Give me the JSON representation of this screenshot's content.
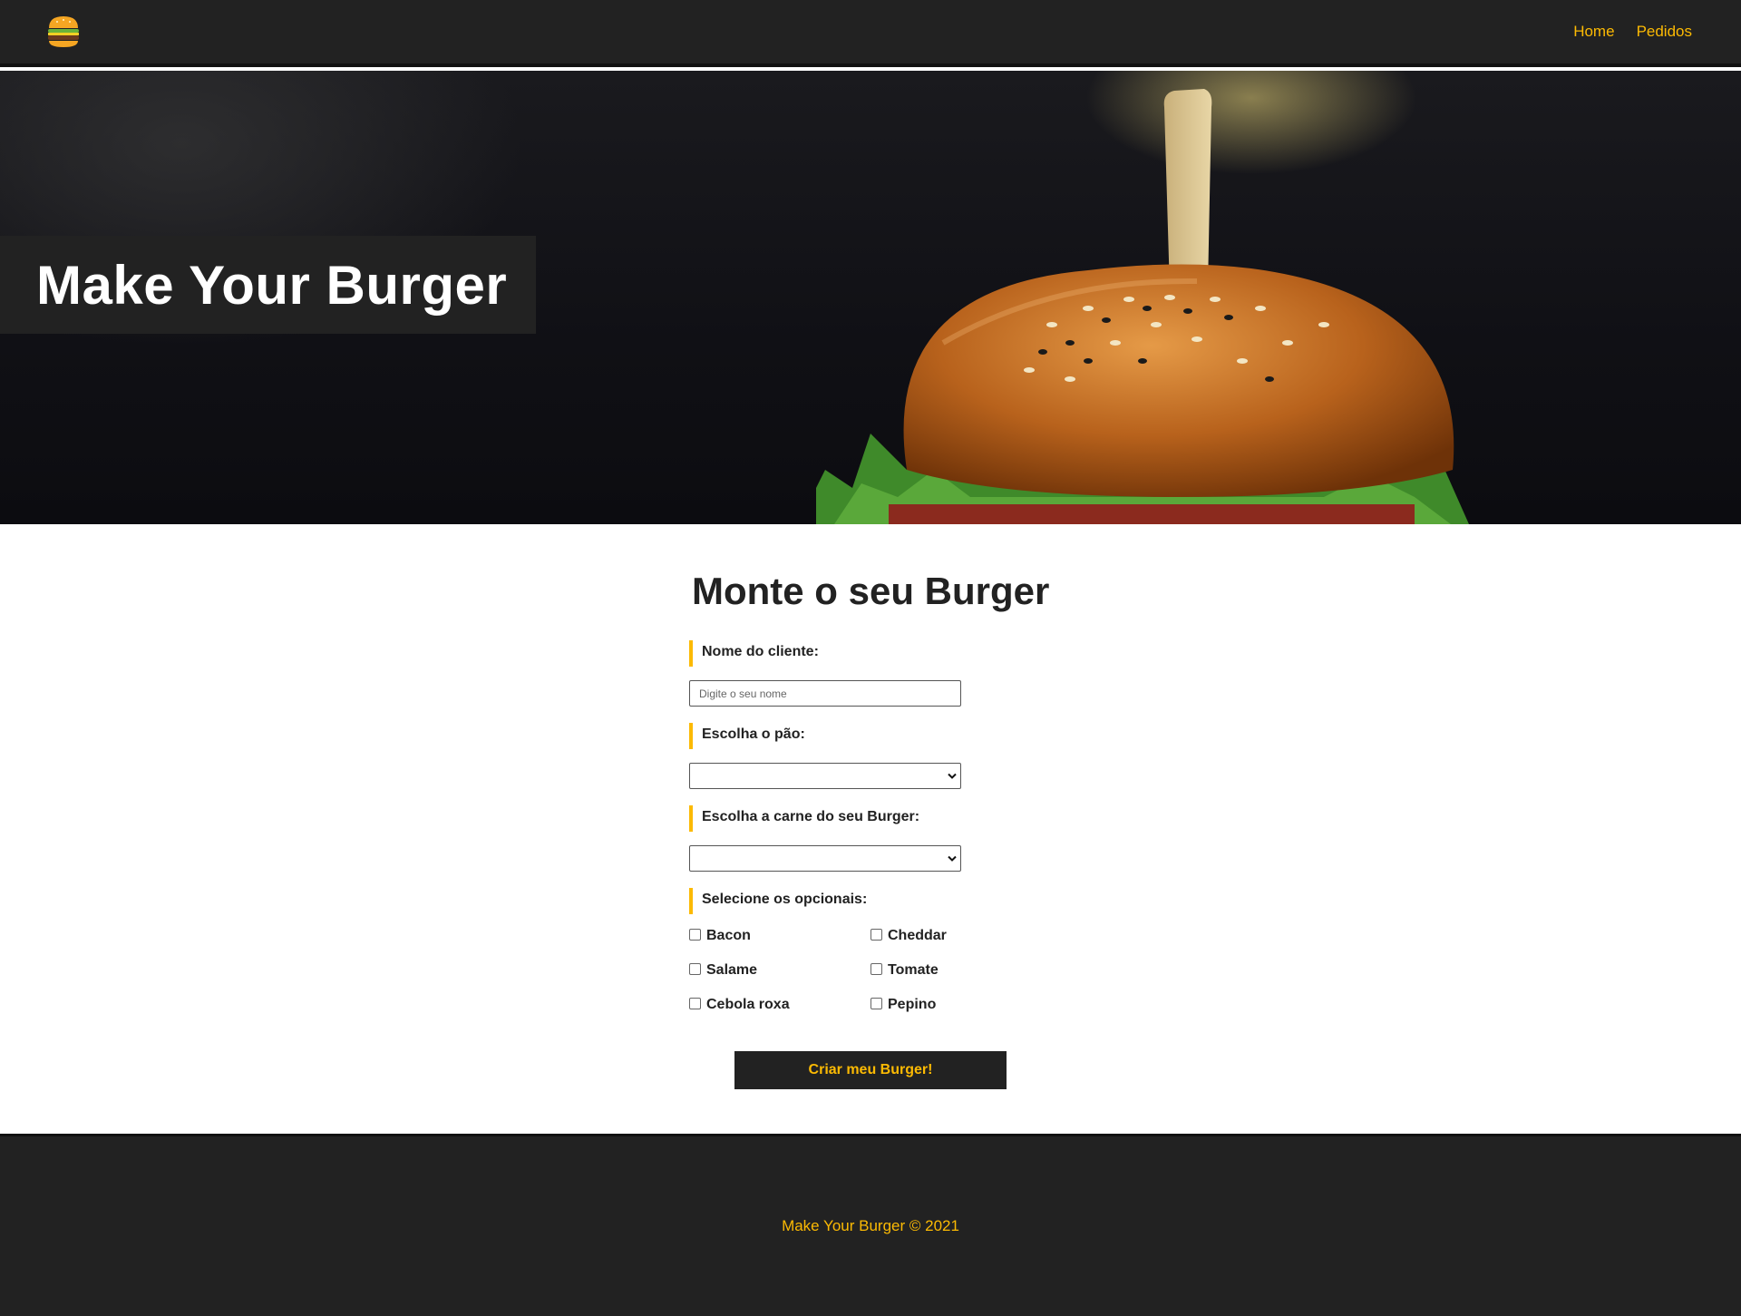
{
  "nav": {
    "logo_icon": "burger-icon",
    "links": [
      {
        "label": "Home"
      },
      {
        "label": "Pedidos"
      }
    ]
  },
  "hero": {
    "title": "Make Your Burger"
  },
  "form": {
    "title": "Monte o seu Burger",
    "name": {
      "label": "Nome do cliente:",
      "placeholder": "Digite o seu nome",
      "value": ""
    },
    "bread": {
      "label": "Escolha o pão:",
      "selected": ""
    },
    "meat": {
      "label": "Escolha a carne do seu Burger:",
      "selected": ""
    },
    "optionals": {
      "label": "Selecione os opcionais:",
      "items": [
        {
          "label": "Bacon",
          "checked": false
        },
        {
          "label": "Cheddar",
          "checked": false
        },
        {
          "label": "Salame",
          "checked": false
        },
        {
          "label": "Tomate",
          "checked": false
        },
        {
          "label": "Cebola roxa",
          "checked": false
        },
        {
          "label": "Pepino",
          "checked": false
        }
      ]
    },
    "submit_label": "Criar meu Burger!"
  },
  "footer": {
    "text": "Make Your Burger © 2021"
  },
  "colors": {
    "accent": "#fcba03",
    "dark": "#222222"
  }
}
